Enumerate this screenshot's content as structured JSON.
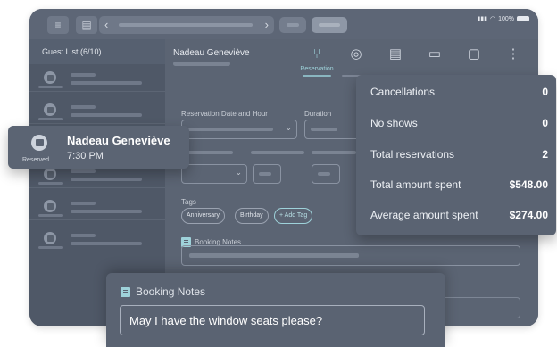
{
  "sidebar": {
    "header": "Guest List (6/10)",
    "rows": 7
  },
  "main": {
    "guest_name": "Nadeau Geneviève",
    "active_tab_label": "Reservation",
    "reservation_date_label": "Reservation Date and Hour",
    "duration_label": "Duration",
    "tags_label": "Tags",
    "tags": [
      "Anniversary",
      "Birthday",
      "+ Add Tag"
    ],
    "booking_notes_label": "Booking Notes"
  },
  "guest_card": {
    "name": "Nadeau Geneviève",
    "time": "7:30 PM",
    "status": "Reserved"
  },
  "stats": [
    {
      "label": "Cancellations",
      "value": "0"
    },
    {
      "label": "No shows",
      "value": "0"
    },
    {
      "label": "Total reservations",
      "value": "2"
    },
    {
      "label": "Total amount spent",
      "value": "$548.00"
    },
    {
      "label": "Average amount spent",
      "value": "$274.00"
    }
  ],
  "notes_card": {
    "title": "Booking Notes",
    "text": "May I have the window seats please?"
  },
  "statusbar": {
    "battery": "100%"
  },
  "icons": [
    "menu-icon",
    "document-icon",
    "back-icon",
    "forward-icon",
    "cutlery-icon",
    "user-circle-icon",
    "file-icon",
    "card-icon",
    "chat-icon",
    "more-icon",
    "note-icon",
    "phone-icon"
  ]
}
